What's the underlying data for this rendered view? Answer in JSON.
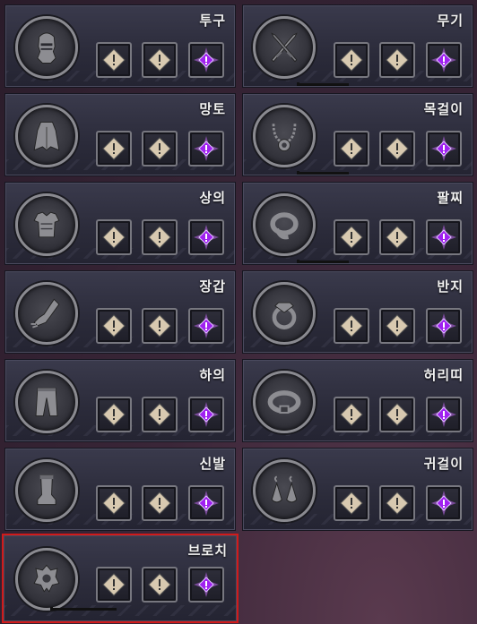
{
  "slots": [
    {
      "label": "투구",
      "icon": "helmet-icon"
    },
    {
      "label": "무기",
      "icon": "crossed-swords-icon"
    },
    {
      "label": "망토",
      "icon": "cloak-icon"
    },
    {
      "label": "목걸이",
      "icon": "necklace-icon"
    },
    {
      "label": "상의",
      "icon": "chest-armor-icon"
    },
    {
      "label": "팔찌",
      "icon": "bracelet-icon"
    },
    {
      "label": "장갑",
      "icon": "gauntlet-icon"
    },
    {
      "label": "반지",
      "icon": "ring-icon"
    },
    {
      "label": "하의",
      "icon": "pants-icon"
    },
    {
      "label": "허리띠",
      "icon": "belt-icon"
    },
    {
      "label": "신발",
      "icon": "boots-icon"
    },
    {
      "label": "귀걸이",
      "icon": "earrings-icon"
    },
    {
      "label": "브로치",
      "icon": "brooch-icon"
    }
  ],
  "socket_icons": [
    "socket-rune-icon",
    "socket-rune-icon",
    "socket-purple-rune-icon"
  ],
  "selected_slot": "브로치",
  "colors": {
    "selected_border": "#d11a1a",
    "rune_beige": "#d8c9b0",
    "rune_purple": "#a020f0"
  }
}
